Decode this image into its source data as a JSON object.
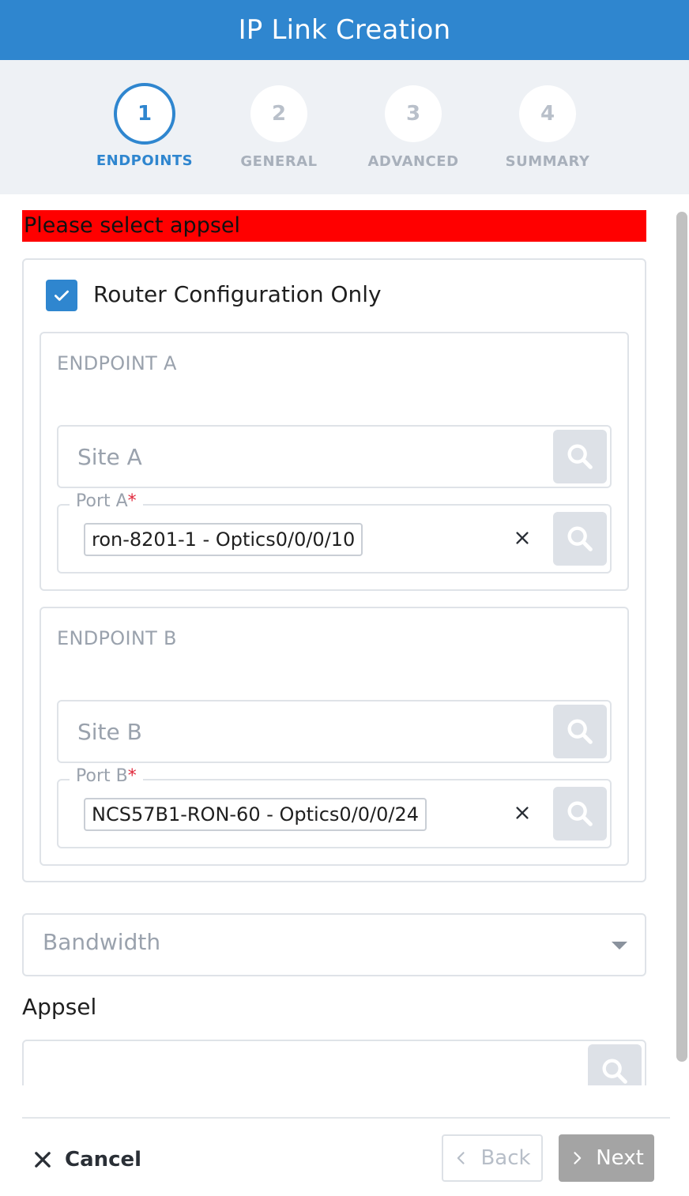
{
  "header": {
    "title": "IP Link Creation"
  },
  "stepper": {
    "steps": [
      {
        "number": "1",
        "label": "ENDPOINTS",
        "active": true
      },
      {
        "number": "2",
        "label": "GENERAL",
        "active": false
      },
      {
        "number": "3",
        "label": "ADVANCED",
        "active": false
      },
      {
        "number": "4",
        "label": "SUMMARY",
        "active": false
      }
    ]
  },
  "error": {
    "message": "Please select appsel"
  },
  "router_config": {
    "label": "Router Configuration Only",
    "checked": true
  },
  "endpoint_a": {
    "title": "ENDPOINT A",
    "site_placeholder": "Site A",
    "port_label": "Port A",
    "port_required": "*",
    "port_value": "ron-8201-1 - Optics0/0/0/10"
  },
  "endpoint_b": {
    "title": "ENDPOINT B",
    "site_placeholder": "Site B",
    "port_label": "Port B",
    "port_required": "*",
    "port_value": "NCS57B1-RON-60 - Optics0/0/0/24"
  },
  "bandwidth": {
    "placeholder": "Bandwidth"
  },
  "appsel": {
    "label": "Appsel",
    "value": ""
  },
  "footer": {
    "cancel_label": "Cancel",
    "back_label": "Back",
    "next_label": "Next"
  },
  "colors": {
    "primary": "#2f86cf",
    "error": "#ff0000",
    "required": "#e0283b",
    "disabled_button": "#a4a4a4"
  },
  "icons": {
    "search": "search-icon",
    "clear": "close-icon",
    "check": "check-icon",
    "caret": "caret-down-icon"
  }
}
